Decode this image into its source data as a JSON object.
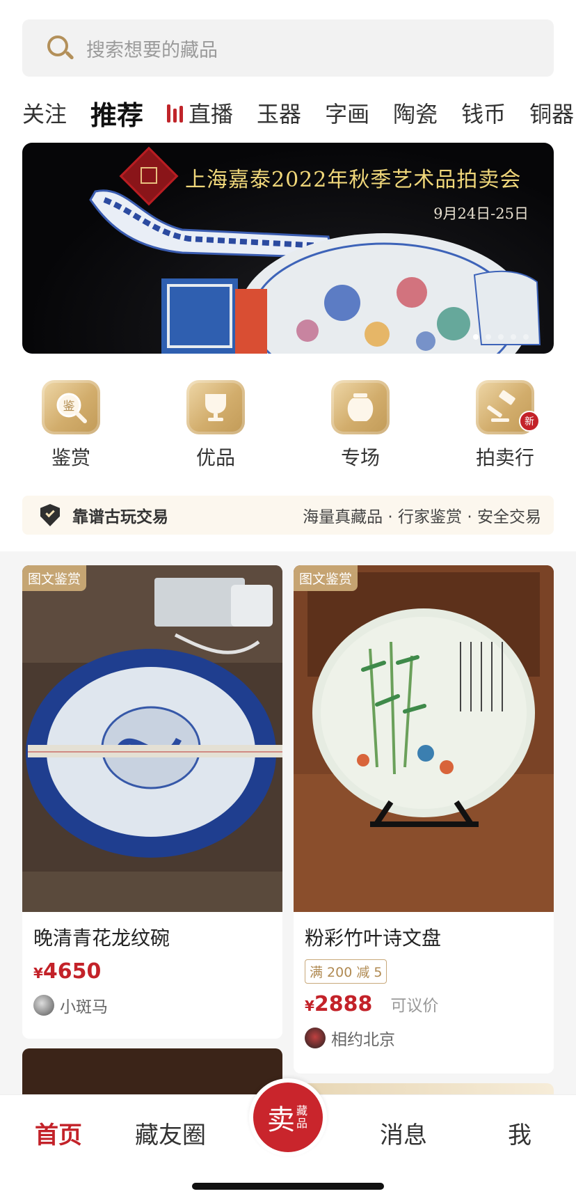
{
  "search": {
    "placeholder": "搜索想要的藏品"
  },
  "tabs": [
    {
      "label": "关注"
    },
    {
      "label": "推荐",
      "active": true
    },
    {
      "label": "直播",
      "icon": "live-bars-icon"
    },
    {
      "label": "玉器"
    },
    {
      "label": "字画"
    },
    {
      "label": "陶瓷"
    },
    {
      "label": "钱币"
    },
    {
      "label": "铜器"
    }
  ],
  "banner": {
    "title": "上海嘉泰2022年秋季艺术品拍卖会",
    "date": "9月24日-25日",
    "slides": 5,
    "current_slide": 1
  },
  "quick": [
    {
      "label": "鉴赏",
      "icon": "appraise-magnifier-icon",
      "glyph": "鉴"
    },
    {
      "label": "优品",
      "icon": "trophy-cup-icon"
    },
    {
      "label": "专场",
      "icon": "jar-icon"
    },
    {
      "label": "拍卖行",
      "icon": "auction-hammer-icon",
      "badge": "新"
    }
  ],
  "trust": {
    "left": "靠谱古玩交易",
    "right": "海量真藏品 · 行家鉴赏 · 安全交易"
  },
  "cards": [
    {
      "tag": "图文鉴赏",
      "title": "晚清青花龙纹碗",
      "currency": "¥",
      "price": "4650",
      "seller": "小斑马"
    },
    {
      "tag": "图文鉴赏",
      "title": "粉彩竹叶诗文盘",
      "coupon": "满 200 减 5",
      "currency": "¥",
      "price": "2888",
      "price_note": "可议价",
      "seller": "相约北京"
    }
  ],
  "nav": {
    "home": "首页",
    "friends": "藏友圈",
    "sell": "卖",
    "sell_sub": "藏品",
    "messages": "消息",
    "me": "我"
  },
  "colors": {
    "brand_red": "#c32229",
    "gold": "#c9a467",
    "tag_gold": "#caaa76"
  }
}
